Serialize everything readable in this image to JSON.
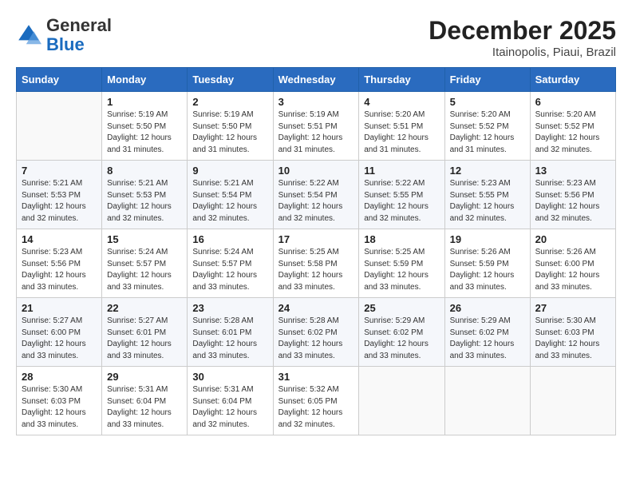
{
  "logo": {
    "general": "General",
    "blue": "Blue"
  },
  "header": {
    "month_title": "December 2025",
    "subtitle": "Itainopolis, Piaui, Brazil"
  },
  "weekdays": [
    "Sunday",
    "Monday",
    "Tuesday",
    "Wednesday",
    "Thursday",
    "Friday",
    "Saturday"
  ],
  "weeks": [
    [
      {
        "day": "",
        "sunrise": "",
        "sunset": "",
        "daylight": ""
      },
      {
        "day": "1",
        "sunrise": "Sunrise: 5:19 AM",
        "sunset": "Sunset: 5:50 PM",
        "daylight": "Daylight: 12 hours and 31 minutes."
      },
      {
        "day": "2",
        "sunrise": "Sunrise: 5:19 AM",
        "sunset": "Sunset: 5:50 PM",
        "daylight": "Daylight: 12 hours and 31 minutes."
      },
      {
        "day": "3",
        "sunrise": "Sunrise: 5:19 AM",
        "sunset": "Sunset: 5:51 PM",
        "daylight": "Daylight: 12 hours and 31 minutes."
      },
      {
        "day": "4",
        "sunrise": "Sunrise: 5:20 AM",
        "sunset": "Sunset: 5:51 PM",
        "daylight": "Daylight: 12 hours and 31 minutes."
      },
      {
        "day": "5",
        "sunrise": "Sunrise: 5:20 AM",
        "sunset": "Sunset: 5:52 PM",
        "daylight": "Daylight: 12 hours and 31 minutes."
      },
      {
        "day": "6",
        "sunrise": "Sunrise: 5:20 AM",
        "sunset": "Sunset: 5:52 PM",
        "daylight": "Daylight: 12 hours and 32 minutes."
      }
    ],
    [
      {
        "day": "7",
        "sunrise": "Sunrise: 5:21 AM",
        "sunset": "Sunset: 5:53 PM",
        "daylight": "Daylight: 12 hours and 32 minutes."
      },
      {
        "day": "8",
        "sunrise": "Sunrise: 5:21 AM",
        "sunset": "Sunset: 5:53 PM",
        "daylight": "Daylight: 12 hours and 32 minutes."
      },
      {
        "day": "9",
        "sunrise": "Sunrise: 5:21 AM",
        "sunset": "Sunset: 5:54 PM",
        "daylight": "Daylight: 12 hours and 32 minutes."
      },
      {
        "day": "10",
        "sunrise": "Sunrise: 5:22 AM",
        "sunset": "Sunset: 5:54 PM",
        "daylight": "Daylight: 12 hours and 32 minutes."
      },
      {
        "day": "11",
        "sunrise": "Sunrise: 5:22 AM",
        "sunset": "Sunset: 5:55 PM",
        "daylight": "Daylight: 12 hours and 32 minutes."
      },
      {
        "day": "12",
        "sunrise": "Sunrise: 5:23 AM",
        "sunset": "Sunset: 5:55 PM",
        "daylight": "Daylight: 12 hours and 32 minutes."
      },
      {
        "day": "13",
        "sunrise": "Sunrise: 5:23 AM",
        "sunset": "Sunset: 5:56 PM",
        "daylight": "Daylight: 12 hours and 32 minutes."
      }
    ],
    [
      {
        "day": "14",
        "sunrise": "Sunrise: 5:23 AM",
        "sunset": "Sunset: 5:56 PM",
        "daylight": "Daylight: 12 hours and 33 minutes."
      },
      {
        "day": "15",
        "sunrise": "Sunrise: 5:24 AM",
        "sunset": "Sunset: 5:57 PM",
        "daylight": "Daylight: 12 hours and 33 minutes."
      },
      {
        "day": "16",
        "sunrise": "Sunrise: 5:24 AM",
        "sunset": "Sunset: 5:57 PM",
        "daylight": "Daylight: 12 hours and 33 minutes."
      },
      {
        "day": "17",
        "sunrise": "Sunrise: 5:25 AM",
        "sunset": "Sunset: 5:58 PM",
        "daylight": "Daylight: 12 hours and 33 minutes."
      },
      {
        "day": "18",
        "sunrise": "Sunrise: 5:25 AM",
        "sunset": "Sunset: 5:59 PM",
        "daylight": "Daylight: 12 hours and 33 minutes."
      },
      {
        "day": "19",
        "sunrise": "Sunrise: 5:26 AM",
        "sunset": "Sunset: 5:59 PM",
        "daylight": "Daylight: 12 hours and 33 minutes."
      },
      {
        "day": "20",
        "sunrise": "Sunrise: 5:26 AM",
        "sunset": "Sunset: 6:00 PM",
        "daylight": "Daylight: 12 hours and 33 minutes."
      }
    ],
    [
      {
        "day": "21",
        "sunrise": "Sunrise: 5:27 AM",
        "sunset": "Sunset: 6:00 PM",
        "daylight": "Daylight: 12 hours and 33 minutes."
      },
      {
        "day": "22",
        "sunrise": "Sunrise: 5:27 AM",
        "sunset": "Sunset: 6:01 PM",
        "daylight": "Daylight: 12 hours and 33 minutes."
      },
      {
        "day": "23",
        "sunrise": "Sunrise: 5:28 AM",
        "sunset": "Sunset: 6:01 PM",
        "daylight": "Daylight: 12 hours and 33 minutes."
      },
      {
        "day": "24",
        "sunrise": "Sunrise: 5:28 AM",
        "sunset": "Sunset: 6:02 PM",
        "daylight": "Daylight: 12 hours and 33 minutes."
      },
      {
        "day": "25",
        "sunrise": "Sunrise: 5:29 AM",
        "sunset": "Sunset: 6:02 PM",
        "daylight": "Daylight: 12 hours and 33 minutes."
      },
      {
        "day": "26",
        "sunrise": "Sunrise: 5:29 AM",
        "sunset": "Sunset: 6:02 PM",
        "daylight": "Daylight: 12 hours and 33 minutes."
      },
      {
        "day": "27",
        "sunrise": "Sunrise: 5:30 AM",
        "sunset": "Sunset: 6:03 PM",
        "daylight": "Daylight: 12 hours and 33 minutes."
      }
    ],
    [
      {
        "day": "28",
        "sunrise": "Sunrise: 5:30 AM",
        "sunset": "Sunset: 6:03 PM",
        "daylight": "Daylight: 12 hours and 33 minutes."
      },
      {
        "day": "29",
        "sunrise": "Sunrise: 5:31 AM",
        "sunset": "Sunset: 6:04 PM",
        "daylight": "Daylight: 12 hours and 33 minutes."
      },
      {
        "day": "30",
        "sunrise": "Sunrise: 5:31 AM",
        "sunset": "Sunset: 6:04 PM",
        "daylight": "Daylight: 12 hours and 32 minutes."
      },
      {
        "day": "31",
        "sunrise": "Sunrise: 5:32 AM",
        "sunset": "Sunset: 6:05 PM",
        "daylight": "Daylight: 12 hours and 32 minutes."
      },
      {
        "day": "",
        "sunrise": "",
        "sunset": "",
        "daylight": ""
      },
      {
        "day": "",
        "sunrise": "",
        "sunset": "",
        "daylight": ""
      },
      {
        "day": "",
        "sunrise": "",
        "sunset": "",
        "daylight": ""
      }
    ]
  ]
}
